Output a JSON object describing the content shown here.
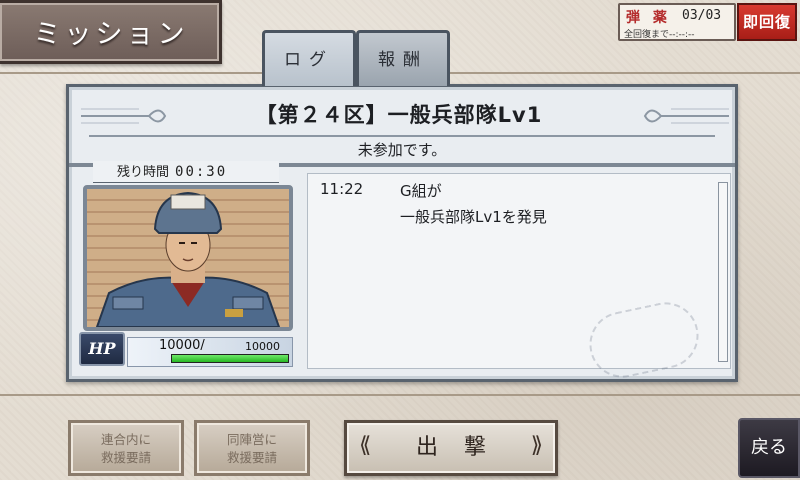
{
  "header": {
    "title": "ミッション",
    "ammo_label": "弾 薬",
    "ammo_count": "03/03",
    "ammo_recover": "全回復まで--:--:--",
    "instant_recover_label": "即回復"
  },
  "tabs": [
    {
      "label": "ログ",
      "active": true
    },
    {
      "label": "報酬",
      "active": false
    }
  ],
  "mission": {
    "name": "【第２４区】一般兵部隊Lv1",
    "status": "未参加です。",
    "timer_label": "残り時間",
    "timer_value": "00:30"
  },
  "hp": {
    "badge": "HP",
    "current": "10000/",
    "max": "10000",
    "fraction": 1.0
  },
  "log": [
    {
      "time": "11:22",
      "line1": "G組が",
      "line2": "一般兵部隊Lv1を発見"
    }
  ],
  "buttons": {
    "rescue_ally_line1": "連合内に",
    "rescue_ally_line2": "救援要請",
    "rescue_camp_line1": "同陣営に",
    "rescue_camp_line2": "救援要請",
    "sortie": "出撃",
    "back": "戻る"
  },
  "colors": {
    "accent_red": "#c22a22",
    "hp_green": "#3cd038",
    "panel_border": "#59636e"
  }
}
